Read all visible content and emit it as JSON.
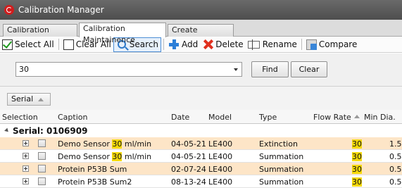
{
  "window": {
    "title": "Calibration Manager"
  },
  "tabs": [
    {
      "label": "Calibration settings"
    },
    {
      "label": "Calibration Maintainence"
    },
    {
      "label": "Create calibration"
    }
  ],
  "toolbar": {
    "select_all": "Select All",
    "clear_all": "Clear All",
    "search": "Search",
    "add": "Add",
    "delete": "Delete",
    "rename": "Rename",
    "compare": "Compare"
  },
  "filter": {
    "query": "30",
    "find": "Find",
    "clear": "Clear"
  },
  "group_panel": {
    "chip": "Serial"
  },
  "columns": {
    "selection": "Selection",
    "caption": "Caption",
    "date": "Date",
    "model": "Model",
    "type": "Type",
    "flow_rate": "Flow Rate",
    "min_dia": "Min Dia."
  },
  "group": {
    "label": "Serial: 0106909"
  },
  "rows": [
    {
      "caption_pre": "Demo Sensor ",
      "caption_hl": "30",
      "caption_post": " ml/min",
      "date": "04-05-21",
      "model": "LE400",
      "type": "Extinction",
      "flow_rate": "30",
      "min_dia": "1.5"
    },
    {
      "caption_pre": "Demo Sensor ",
      "caption_hl": "30",
      "caption_post": " ml/min",
      "date": "04-05-21",
      "model": "LE400",
      "type": "Summation",
      "flow_rate": "30",
      "min_dia": "0.5"
    },
    {
      "caption_pre": "Protein P53B Sum",
      "caption_hl": "",
      "caption_post": "",
      "date": "02-07-24",
      "model": "LE400",
      "type": "Summation",
      "flow_rate": "30",
      "min_dia": "0.5"
    },
    {
      "caption_pre": "Protein P53B Sum2",
      "caption_hl": "",
      "caption_post": "",
      "date": "08-13-24",
      "model": "LE400",
      "type": "Summation",
      "flow_rate": "30",
      "min_dia": "0.5"
    }
  ],
  "colors": {
    "highlight": "#f5d90b",
    "alt_row": "#fde5c7",
    "accent": "#2d79c9"
  }
}
